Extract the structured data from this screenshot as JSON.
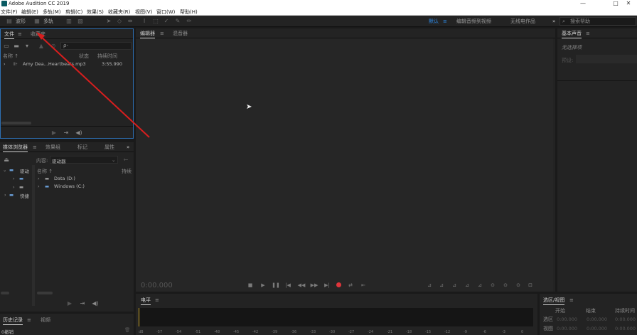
{
  "titlebar": {
    "title": "Adobe Audition CC 2019",
    "minimize": "—",
    "maximize": "□",
    "close": "✕"
  },
  "menu": [
    "文件(F)",
    "编辑(E)",
    "多轨(M)",
    "剪辑(C)",
    "效果(S)",
    "收藏夹(R)",
    "视图(V)",
    "窗口(W)",
    "帮助(H)"
  ],
  "toolbar": {
    "waveform_label": "波形",
    "multitrack_label": "多轨",
    "workspaces": [
      "默认",
      "编辑音频到视频",
      "无线电作品"
    ],
    "active_workspace": "默认",
    "more": "»",
    "search_placeholder": "搜索帮助"
  },
  "files_panel": {
    "tabs": [
      "文件",
      "收藏夹"
    ],
    "menu_icon": "≡",
    "search_icon": "ρ-",
    "columns": {
      "name": "名称 ↑",
      "status": "状态",
      "duration": "持续时间"
    },
    "rows": [
      {
        "expand": "›",
        "name": "Amy Dea...Heartbeats.mp3",
        "duration": "3:55.990"
      }
    ],
    "footer_icons": [
      "▶",
      "⇥",
      "◀)"
    ]
  },
  "media_browser": {
    "tabs": [
      "媒体浏览器",
      "效果组",
      "标记",
      "属性"
    ],
    "menu_icon": "≡",
    "more": "»",
    "content_label": "内容:",
    "content_value": "驱动器",
    "tree": [
      {
        "label": "驱动"
      },
      {
        "label": "快捷"
      }
    ],
    "columns": {
      "name": "名称 ↑",
      "duration": "持续"
    },
    "rows": [
      {
        "name": "Data (D:)"
      },
      {
        "name": "Windows (C:)"
      }
    ],
    "footer_icons": [
      "▶",
      "⇥",
      "◀)"
    ]
  },
  "history_panel": {
    "tabs": [
      "历史记录",
      "视频"
    ],
    "menu_icon": "≡",
    "item": "0撤销"
  },
  "editor": {
    "tabs": [
      "编辑器",
      "混音器"
    ],
    "menu_icon": "≡",
    "time": "0:00.000"
  },
  "levels_panel": {
    "title": "电平",
    "menu_icon": "≡",
    "scale": [
      "dB",
      "-57",
      "-54",
      "-51",
      "-48",
      "-45",
      "-42",
      "-39",
      "-36",
      "-33",
      "-30",
      "-27",
      "-24",
      "-21",
      "-18",
      "-15",
      "-12",
      "-9",
      "-6",
      "-3",
      "0"
    ]
  },
  "essential_sound": {
    "title": "基本声音",
    "menu_icon": "≡",
    "subtitle": "无选择项",
    "preset_label": "预设:"
  },
  "selection_view": {
    "title": "选区/视图",
    "menu_icon": "≡",
    "columns": [
      "开始",
      "结束",
      "持续时间"
    ],
    "rows": [
      {
        "label": "选区",
        "start": "0:00.000",
        "end": "0:00.000",
        "duration": "0:00.000"
      },
      {
        "label": "视图",
        "start": "0:00.000",
        "end": "0:00.000",
        "duration": "0:00.000"
      }
    ]
  },
  "colors": {
    "accent": "#2d8ceb",
    "record": "#e0353b",
    "annotation_arrow": "#d81e1e"
  }
}
